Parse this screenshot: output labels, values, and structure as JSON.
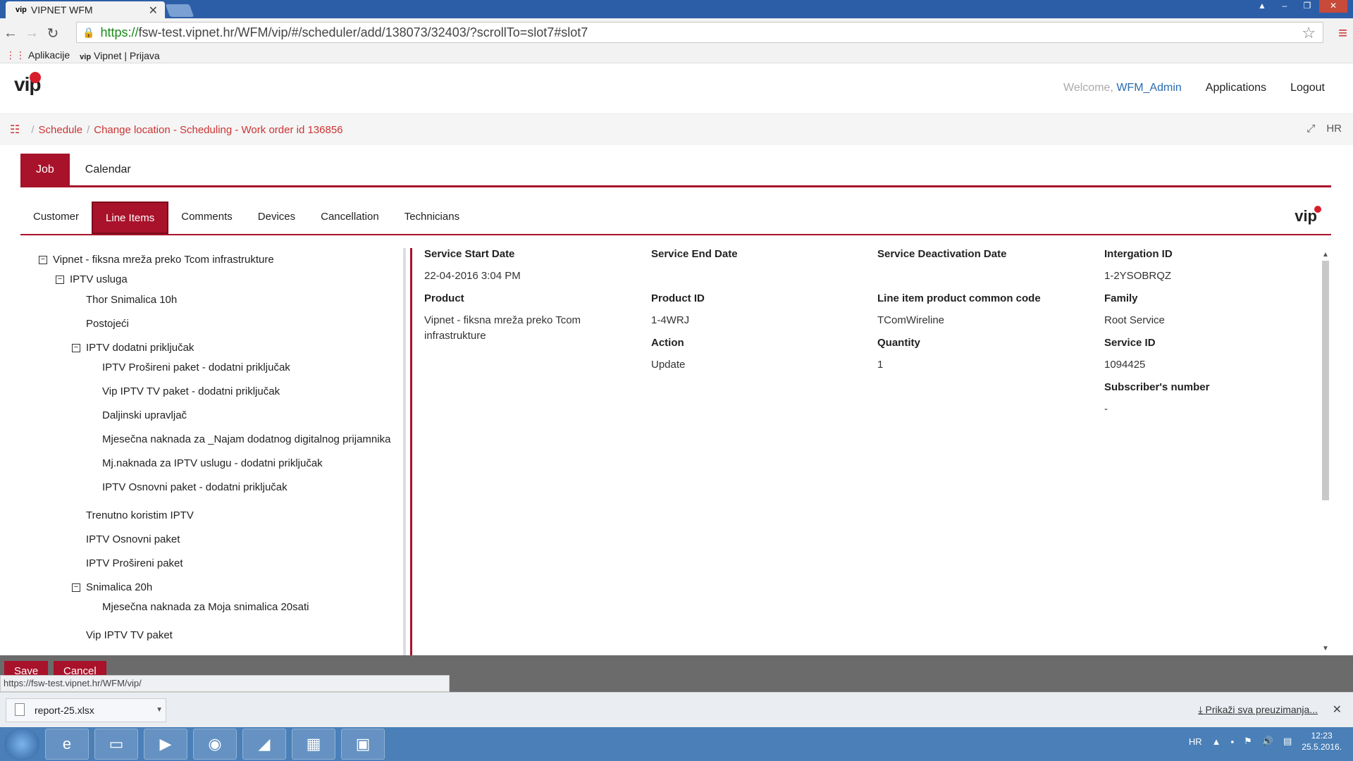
{
  "browser": {
    "tab_title": "VIPNET WFM",
    "tab_favicon": "vip",
    "url_https": "https://",
    "url_rest": "fsw-test.vipnet.hr/WFM/vip/#/scheduler/add/138073/32403/?scrollTo=slot7#slot7",
    "bookmarks": [
      {
        "label": "Aplikacije",
        "icon": "apps-grid-icon"
      },
      {
        "label": "Vipnet | Prijava",
        "icon": "vip"
      }
    ]
  },
  "header": {
    "logo": "vip",
    "welcome_prefix": "Welcome,",
    "user": "WFM_Admin",
    "applications": "Applications",
    "logout": "Logout"
  },
  "breadcrumb": {
    "items": [
      "Schedule",
      "Change location - Scheduling - Work order id 136856"
    ],
    "lang": "HR"
  },
  "main_tabs": [
    {
      "label": "Job",
      "active": true
    },
    {
      "label": "Calendar",
      "active": false
    }
  ],
  "sub_tabs": [
    {
      "label": "Customer",
      "active": false
    },
    {
      "label": "Line Items",
      "active": true
    },
    {
      "label": "Comments",
      "active": false
    },
    {
      "label": "Devices",
      "active": false
    },
    {
      "label": "Cancellation",
      "active": false
    },
    {
      "label": "Technicians",
      "active": false
    }
  ],
  "tree": {
    "root": "Vipnet - fiksna mreža preko Tcom infrastrukture",
    "iptv_usluga": "IPTV usluga",
    "thor": "Thor Snimalica 10h",
    "postojeci": "Postojeći",
    "dodatni": "IPTV dodatni priključak",
    "d1": "IPTV Prošireni paket - dodatni priključak",
    "d2": "Vip IPTV TV paket - dodatni priključak",
    "d3": "Daljinski upravljač",
    "d4": "Mjesečna naknada za _Najam dodatnog digitalnog prijamnika",
    "d5": "Mj.naknada za IPTV uslugu - dodatni priključak",
    "d6": "IPTV Osnovni paket - dodatni priključak",
    "trenutno": "Trenutno koristim IPTV",
    "osnovni": "IPTV Osnovni paket",
    "prosireni": "IPTV Prošireni paket",
    "snimalica": "Snimalica 20h",
    "snim_child": "Mjesečna naknada za Moja snimalica 20sati",
    "vip_tv": "Vip IPTV TV paket"
  },
  "details": {
    "service_start_label": "Service Start Date",
    "service_start": "22-04-2016 3:04 PM",
    "service_end_label": "Service End Date",
    "service_end": "",
    "service_deact_label": "Service Deactivation Date",
    "service_deact": "",
    "integration_label": "Intergation ID",
    "integration": "1-2YSOBRQZ",
    "product_label": "Product",
    "product": "Vipnet - fiksna mreža preko Tcom infrastrukture",
    "product_id_label": "Product ID",
    "product_id": "1-4WRJ",
    "common_code_label": "Line item product common code",
    "common_code": "TComWireline",
    "family_label": "Family",
    "family": "Root Service",
    "action_label": "Action",
    "action": "Update",
    "quantity_label": "Quantity",
    "quantity": "1",
    "service_id_label": "Service ID",
    "service_id": "1094425",
    "subscriber_label": "Subscriber's number",
    "subscriber": "-"
  },
  "footer": {
    "save": "Save",
    "cancel": "Cancel",
    "status_url": "https://fsw-test.vipnet.hr/WFM/vip/"
  },
  "downloads": {
    "file": "report-25.xlsx",
    "show_all": "Prikaži sva preuzimanja..."
  },
  "taskbar": {
    "lang": "HR",
    "time": "12:23",
    "date": "25.5.2016."
  }
}
